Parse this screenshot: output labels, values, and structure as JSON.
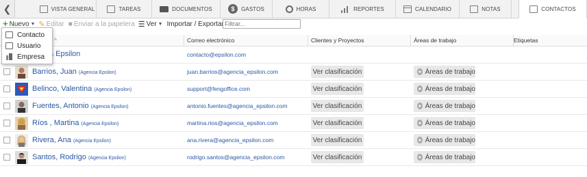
{
  "tabs": [
    {
      "label": "Vista general",
      "icon": "overview-icon"
    },
    {
      "label": "Tareas",
      "icon": "tasks-icon"
    },
    {
      "label": "Documentos",
      "icon": "folder-icon"
    },
    {
      "label": "Gastos",
      "icon": "dollar-icon"
    },
    {
      "label": "Horas",
      "icon": "clock-icon"
    },
    {
      "label": "Reportes",
      "icon": "bar-chart-icon"
    },
    {
      "label": "Calendario",
      "icon": "calendar-icon"
    },
    {
      "label": "Notas",
      "icon": "notes-icon"
    },
    {
      "label": "Contactos",
      "icon": "contacts-icon",
      "active": true
    }
  ],
  "toolbar": {
    "new_label": "Nuevo",
    "edit_label": "Editar",
    "trash_label": "Enviar a la papelera",
    "view_label": "Ver",
    "import_label": "Importar / Exportar",
    "filter_placeholder": "Filtrar..."
  },
  "new_menu": {
    "items": [
      {
        "label": "Contacto",
        "icon": "contact-card-icon"
      },
      {
        "label": "Usuario",
        "icon": "user-card-icon"
      },
      {
        "label": "Empresa",
        "icon": "building-icon"
      }
    ]
  },
  "columns": {
    "email": "Correo electrónico",
    "clients": "Clientes y Proyectos",
    "areas": "Áreas de trabajo",
    "tags": "Etiquetas"
  },
  "rows": [
    {
      "name": "Agencia Epsilon",
      "name_visible": "a Epsilon",
      "company": "",
      "email": "contacto@epsilon.com",
      "has_buttons": false
    },
    {
      "name": "Barrios, Juan",
      "company": "(Agencia Epsilon)",
      "email": "juan.barrios@agencia_epsilon.com",
      "has_buttons": true
    },
    {
      "name": "Belinco, Valentina",
      "company": "(Agencia Epsilon)",
      "email": "support@fengoffice.com",
      "has_buttons": true
    },
    {
      "name": "Fuentes, Antonio",
      "company": "(Agencia Epsilon)",
      "email": "antonio.fuentes@agencia_epsilon.com",
      "has_buttons": true
    },
    {
      "name": "Ríos , Martina",
      "company": "(Agencia Epsilon)",
      "email": "martina.rios@agencia_epsilon.com",
      "has_buttons": true
    },
    {
      "name": "Rivera, Ana",
      "company": "(Agencia Epsilon)",
      "email": "ana.rivera@agencia_epsilon.com",
      "has_buttons": true
    },
    {
      "name": "Santos, Rodrigo",
      "company": "(Agencia Epsilon)",
      "email": "rodrigo.santos@agencia_epsilon.com",
      "has_buttons": true
    }
  ],
  "row_buttons": {
    "classify": "Ver clasificación",
    "areas": "Áreas de trabajo"
  },
  "colors": {
    "link": "#2a57a5",
    "new_plus": "#3aa33a"
  }
}
